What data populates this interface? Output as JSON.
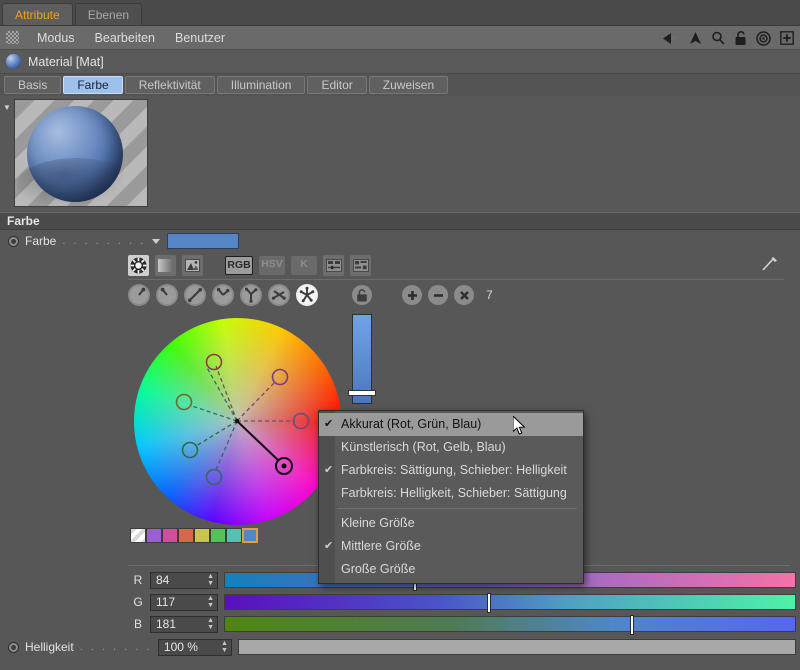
{
  "window": {
    "tabs": [
      {
        "label": "Attribute",
        "active": true
      },
      {
        "label": "Ebenen",
        "active": false
      }
    ]
  },
  "menubar": {
    "grip_icon": "grip-dots-icon",
    "items": [
      "Modus",
      "Bearbeiten",
      "Benutzer"
    ],
    "toolbar_icons": [
      "back-arrow-icon",
      "up-arrow-icon",
      "search-icon",
      "lock-open-icon",
      "target-icon",
      "add-box-icon"
    ]
  },
  "object": {
    "icon": "material-sphere-icon",
    "title": "Material [Mat]"
  },
  "attribute_tabs": [
    {
      "label": "Basis",
      "active": false
    },
    {
      "label": "Farbe",
      "active": true
    },
    {
      "label": "Reflektivität",
      "active": false
    },
    {
      "label": "Illumination",
      "active": false
    },
    {
      "label": "Editor",
      "active": false
    },
    {
      "label": "Zuweisen",
      "active": false
    }
  ],
  "preview": {
    "twisty_icon": "triangle-down-icon",
    "sphere_icon": "material-preview-sphere"
  },
  "section": {
    "title": "Farbe"
  },
  "color_row": {
    "radio_icon": "radio-button-icon",
    "label": "Farbe",
    "dots": ". . . . . . . .",
    "caret_icon": "chevron-down-icon",
    "swatch_color": "#5585c4"
  },
  "mode_row": {
    "icons": [
      "color-wheel-icon",
      "gradient-icon",
      "image-icon"
    ],
    "buttons": [
      {
        "label": "RGB",
        "active": true
      },
      {
        "label": "HSV",
        "active": false
      },
      {
        "label": "K",
        "active": false
      }
    ],
    "extra_icons": [
      "sliders-icon",
      "swatches-icon"
    ],
    "picker_icon": "eyedropper-icon"
  },
  "harmony_row": {
    "icons": [
      "harmony-single-icon",
      "harmony-complement-icon",
      "harmony-split-icon",
      "harmony-triad-icon",
      "harmony-tetrad-icon",
      "harmony-analogous-icon",
      "harmony-custom-icon"
    ],
    "selected_index": 6,
    "lock_icon": "lock-open-icon",
    "add_icon": "plus-icon",
    "remove_icon": "minus-icon",
    "clear_icon": "close-x-icon",
    "count": "7"
  },
  "wheel": {
    "markers": 7,
    "slider_top_color": "#6fa3ea",
    "slider_bottom_color": "#4a78bd"
  },
  "swatches": [
    {
      "name": "transparent-swatch",
      "color": "checker"
    },
    {
      "name": "swatch-purple",
      "color": "#9a5fd0"
    },
    {
      "name": "swatch-magenta",
      "color": "#d04f9a"
    },
    {
      "name": "swatch-orange",
      "color": "#d4684f"
    },
    {
      "name": "swatch-yellow",
      "color": "#c6c64f"
    },
    {
      "name": "swatch-green",
      "color": "#56c05a"
    },
    {
      "name": "swatch-teal",
      "color": "#58c0b0"
    },
    {
      "name": "swatch-blue-current",
      "color": "#5585c4",
      "current": true
    }
  ],
  "rgb": [
    {
      "channel": "R",
      "value": "84",
      "pos_pct": 33,
      "grad_from": "#1580bb",
      "grad_mid": "#6f5fc4",
      "grad_to": "#f472a8"
    },
    {
      "channel": "G",
      "value": "117",
      "pos_pct": 46,
      "grad_from": "#5a0fbe",
      "grad_mid": "#4f87c8",
      "grad_to": "#4ef2a8"
    },
    {
      "channel": "B",
      "value": "181",
      "pos_pct": 71,
      "grad_from": "#4f8511",
      "grad_mid": "#4f87c8",
      "grad_to": "#5566f0"
    }
  ],
  "brightness": {
    "radio_icon": "radio-button-icon",
    "label": "Helligkeit",
    "dots": ". . . . . . .",
    "value": "100 %"
  },
  "popup_menu": {
    "groups": [
      {
        "items": [
          {
            "label": "Akkurat (Rot, Grün, Blau)",
            "checked": true,
            "highlighted": true
          },
          {
            "label": "Künstlerisch (Rot, Gelb, Blau)",
            "checked": false,
            "highlighted": false
          },
          {
            "label": "Farbkreis: Sättigung, Schieber: Helligkeit",
            "checked": true,
            "highlighted": false
          },
          {
            "label": "Farbkreis: Helligkeit, Schieber: Sättigung",
            "checked": false,
            "highlighted": false
          }
        ]
      },
      {
        "items": [
          {
            "label": "Kleine Größe",
            "checked": false,
            "highlighted": false
          },
          {
            "label": "Mittlere Größe",
            "checked": true,
            "highlighted": false
          },
          {
            "label": "Große Größe",
            "checked": false,
            "highlighted": false
          }
        ]
      }
    ],
    "check_glyph": "✔"
  },
  "cursor": {
    "icon": "mouse-pointer-icon"
  }
}
